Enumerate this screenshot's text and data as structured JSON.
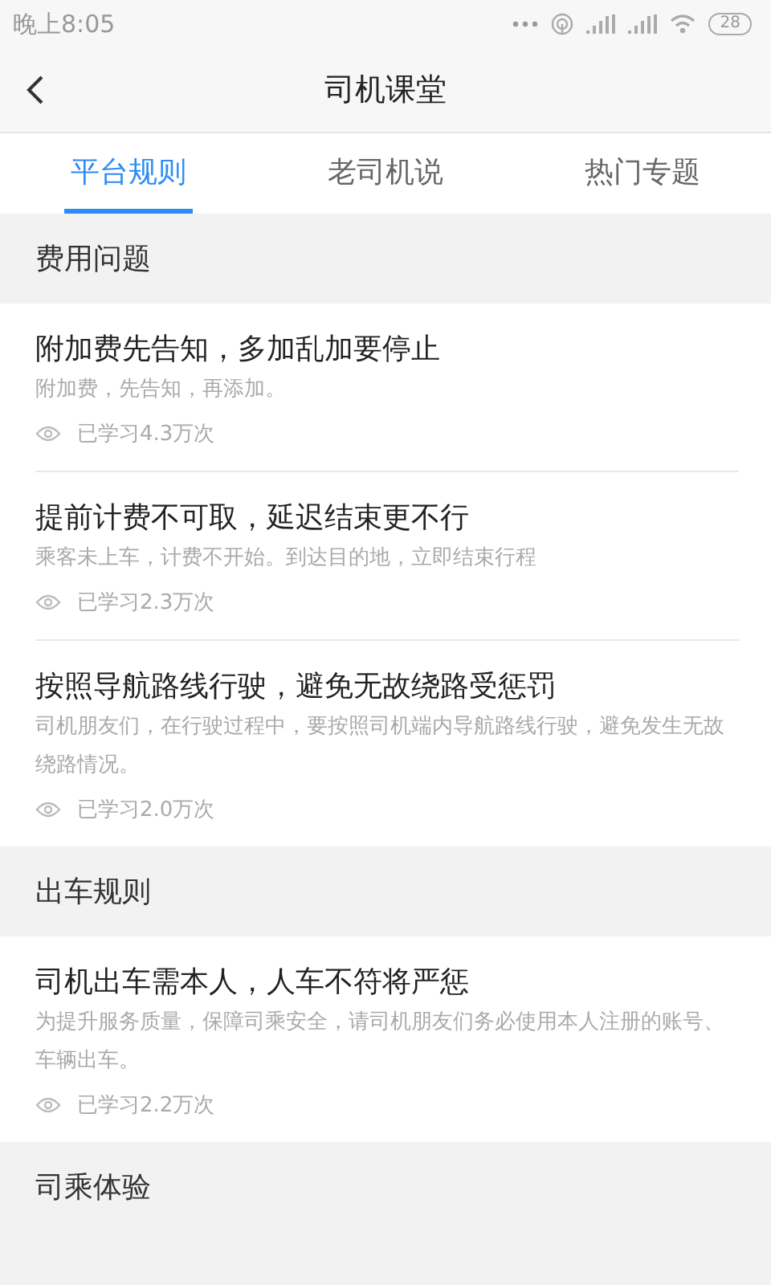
{
  "status_bar": {
    "time": "晚上8:05",
    "battery": "28"
  },
  "header": {
    "title": "司机课堂"
  },
  "tabs": [
    {
      "label": "平台规则",
      "selected": true
    },
    {
      "label": "老司机说",
      "selected": false
    },
    {
      "label": "热门专题",
      "selected": false
    }
  ],
  "sections": [
    {
      "title": "费用问题",
      "articles": [
        {
          "title": "附加费先告知，多加乱加要停止",
          "summary": "附加费，先告知，再添加。",
          "views": "已学习4.3万次"
        },
        {
          "title": "提前计费不可取，延迟结束更不行",
          "summary": "乘客未上车，计费不开始。到达目的地，立即结束行程",
          "views": "已学习2.3万次"
        },
        {
          "title": "按照导航路线行驶，避免无故绕路受惩罚",
          "summary": "司机朋友们，在行驶过程中，要按照司机端内导航路线行驶，避免发生无故绕路情况。",
          "views": "已学习2.0万次"
        }
      ]
    },
    {
      "title": "出车规则",
      "articles": [
        {
          "title": "司机出车需本人，人车不符将严惩",
          "summary": "为提升服务质量，保障司乘安全，请司机朋友们务必使用本人注册的账号、车辆出车。",
          "views": "已学习2.2万次"
        }
      ]
    },
    {
      "title": "司乘体验"
    }
  ]
}
